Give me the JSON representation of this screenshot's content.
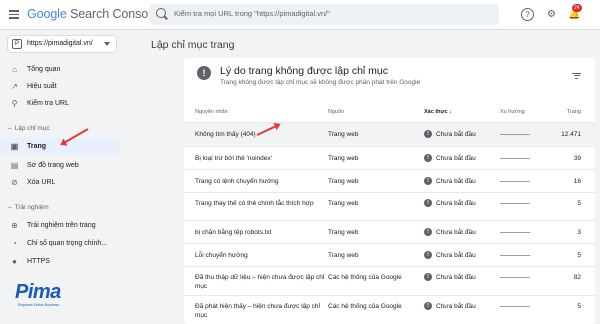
{
  "header": {
    "logo_google": "Google",
    "logo_product": "Search Console",
    "search_placeholder": "Kiểm tra mọi URL trong \"https://pimadigital.vn/\"",
    "badge": "24"
  },
  "sidebar": {
    "property": "https://pimadigital.vn/",
    "items": [
      {
        "label": "Tổng quan",
        "icon": "home-icon"
      },
      {
        "label": "Hiệu suất",
        "icon": "trending-icon"
      },
      {
        "label": "Kiểm tra URL",
        "icon": "search-icon"
      }
    ],
    "section_index": "Lập chỉ mục",
    "index_items": [
      {
        "label": "Trang",
        "icon": "pages-icon"
      },
      {
        "label": "Sơ đồ trang web",
        "icon": "sitemap-icon"
      },
      {
        "label": "Xóa URL",
        "icon": "remove-icon"
      }
    ],
    "section_experience": "Trải nghiệm",
    "exp_items": [
      {
        "label": "Trải nghiệm trên trang",
        "icon": "experience-icon"
      },
      {
        "label": "Chỉ số quan trọng chính...",
        "icon": "speed-icon"
      },
      {
        "label": "HTTPS",
        "icon": "lock-icon"
      }
    ],
    "brand": "Pima",
    "brand_tagline": "Empower Online Business"
  },
  "main": {
    "page_title": "Lập chỉ mục trang",
    "card_title": "Lý do trang không được lập chỉ mục",
    "card_subtitle": "Trang không được lập chỉ mục sẽ không được phân phát trên Google",
    "columns": {
      "reason": "Nguyên nhân",
      "source": "Nguồn",
      "validation": "Xác thực",
      "trend": "Xu hướng",
      "pages": "Trang"
    },
    "rows": [
      {
        "reason": "Không tìm thấy (404)",
        "source": "Trang web",
        "validation": "Chưa bắt đầu",
        "pages": "12.471"
      },
      {
        "reason": "Bị loại trừ bởi thẻ 'noindex'",
        "source": "Trang web",
        "validation": "Chưa bắt đầu",
        "pages": "39"
      },
      {
        "reason": "Trang có lệnh chuyển hướng",
        "source": "Trang web",
        "validation": "Chưa bắt đầu",
        "pages": "16"
      },
      {
        "reason": "Trang thay thế có thẻ chính tắc thích hợp",
        "source": "Trang web",
        "validation": "Chưa bắt đầu",
        "pages": "5"
      },
      {
        "reason": "bị chặn bằng tệp robots.txt",
        "source": "Trang web",
        "validation": "Chưa bắt đầu",
        "pages": "3"
      },
      {
        "reason": "Lỗi chuyển hướng",
        "source": "Trang web",
        "validation": "Chưa bắt đầu",
        "pages": "5"
      },
      {
        "reason": "Đã thu thập dữ liệu – hiện chưa được lập chỉ mục",
        "source": "Các hệ thống của Google",
        "validation": "Chưa bắt đầu",
        "pages": "82"
      },
      {
        "reason": "Đã phát hiện thấy – hiện chưa được lập chỉ mục",
        "source": "Các hệ thống của Google",
        "validation": "Chưa bắt đầu",
        "pages": "5"
      }
    ]
  },
  "colors": {
    "accent": "#1a73e8",
    "active_bg": "#e8f0fe",
    "arrow": "#e53935",
    "brand": "#1a5bb8"
  }
}
